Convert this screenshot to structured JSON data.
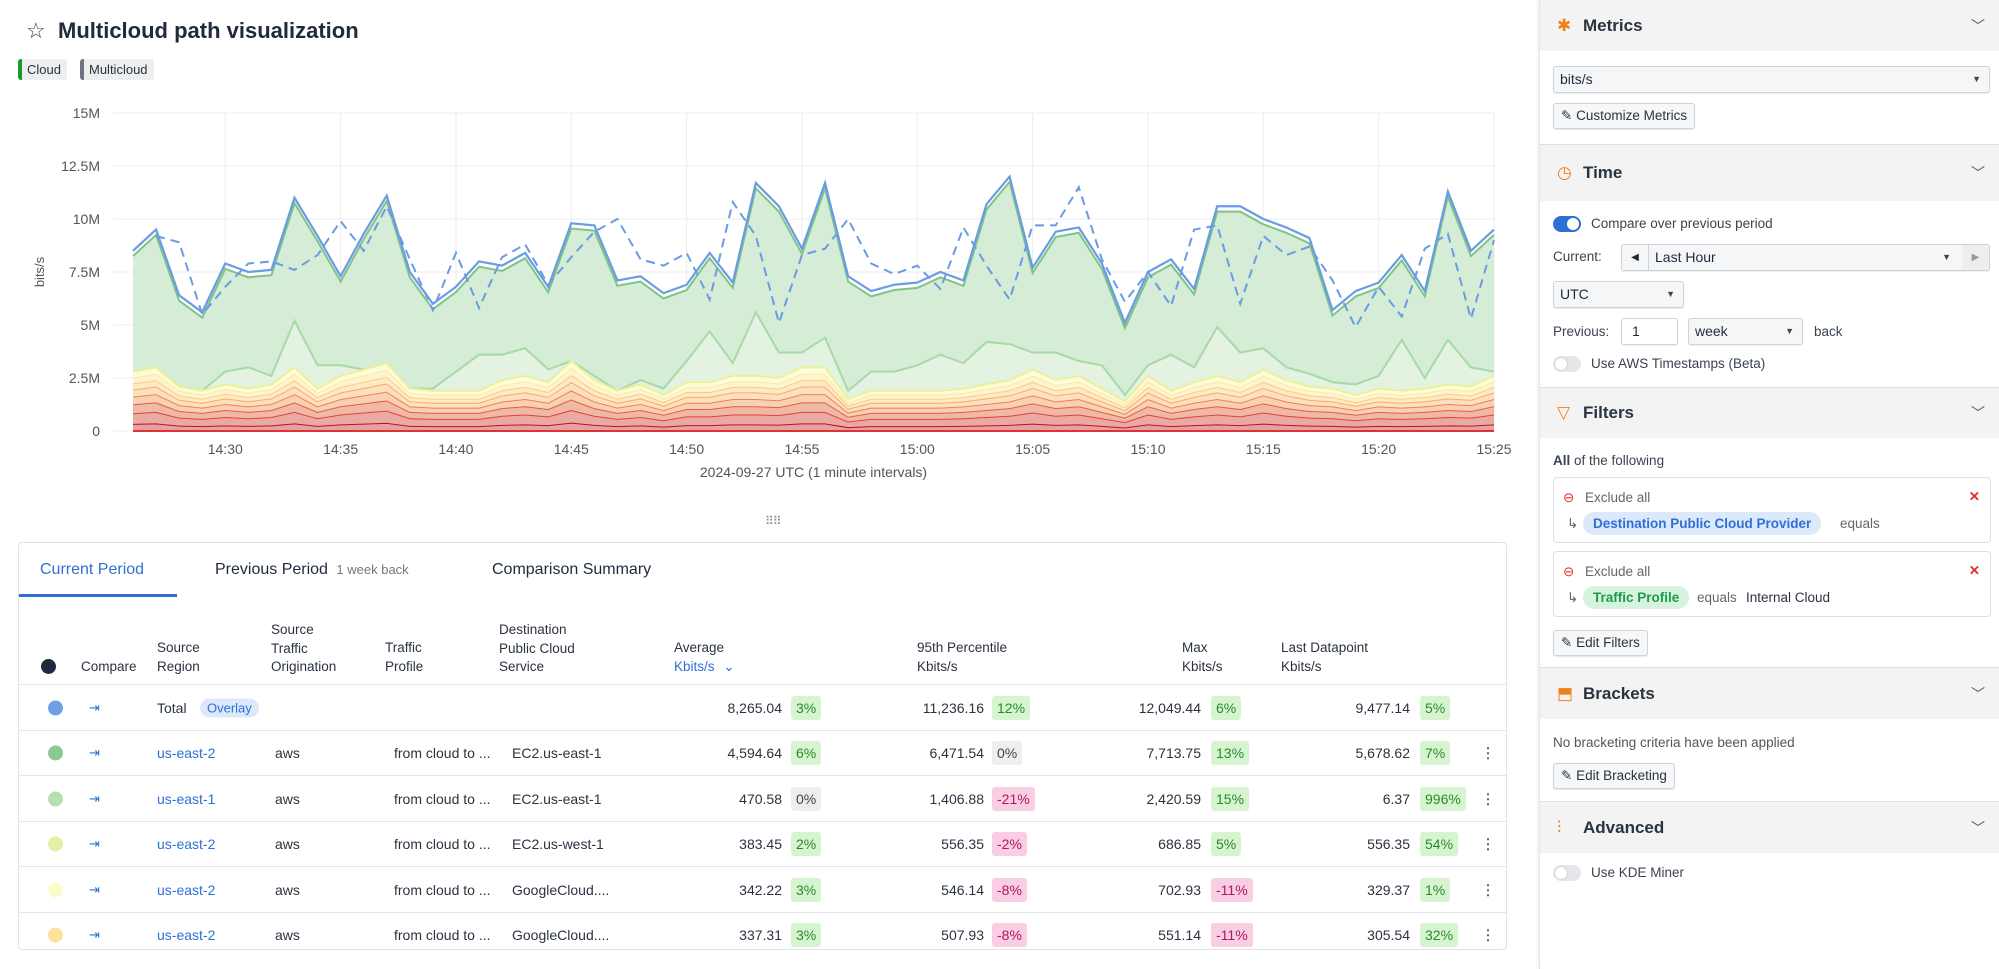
{
  "header": {
    "title": "Multicloud path visualization",
    "tags": [
      {
        "label": "Cloud",
        "color": "#1a9a2a"
      },
      {
        "label": "Multicloud",
        "color": "#6b7480"
      }
    ]
  },
  "chart_data": {
    "type": "area",
    "ylabel": "bits/s",
    "xlabel": "2024-09-27 UTC (1 minute intervals)",
    "ylim": [
      0,
      15000000
    ],
    "yticks": [
      "0",
      "2.5M",
      "5M",
      "7.5M",
      "10M",
      "12.5M",
      "15M"
    ],
    "ytick_values": [
      0,
      2.5,
      5,
      7.5,
      10,
      12.5,
      15
    ],
    "xticks": [
      "14:30",
      "14:35",
      "14:40",
      "14:45",
      "14:50",
      "14:55",
      "15:00",
      "15:05",
      "15:10",
      "15:15",
      "15:20",
      "15:25"
    ],
    "grid": true,
    "x": [
      "14:26",
      "14:27",
      "14:28",
      "14:29",
      "14:30",
      "14:31",
      "14:32",
      "14:33",
      "14:34",
      "14:35",
      "14:36",
      "14:37",
      "14:38",
      "14:39",
      "14:40",
      "14:41",
      "14:42",
      "14:43",
      "14:44",
      "14:45",
      "14:46",
      "14:47",
      "14:48",
      "14:49",
      "14:50",
      "14:51",
      "14:52",
      "14:53",
      "14:54",
      "14:55",
      "14:56",
      "14:57",
      "14:58",
      "14:59",
      "15:00",
      "15:01",
      "15:02",
      "15:03",
      "15:04",
      "15:05",
      "15:06",
      "15:07",
      "15:08",
      "15:09",
      "15:10",
      "15:11",
      "15:12",
      "15:13",
      "15:14",
      "15:15",
      "15:16",
      "15:17",
      "15:18",
      "15:19",
      "15:20",
      "15:21",
      "15:22",
      "15:23",
      "15:24",
      "15:25"
    ],
    "units": "M bits/s",
    "series": [
      {
        "role": "total",
        "color": "#6a9be3",
        "style": "solid",
        "values": [
          8.5,
          9.5,
          6.4,
          5.6,
          7.9,
          7.5,
          7.6,
          11.0,
          9.2,
          7.3,
          9.3,
          11.1,
          7.5,
          6.0,
          6.8,
          8.0,
          7.8,
          8.4,
          6.8,
          9.8,
          9.7,
          7.1,
          7.3,
          6.5,
          6.9,
          8.4,
          7.0,
          11.7,
          10.6,
          8.6,
          11.7,
          7.3,
          6.6,
          6.9,
          7.0,
          7.5,
          7.1,
          10.7,
          12.0,
          7.7,
          9.4,
          9.6,
          7.9,
          5.1,
          7.5,
          8.1,
          6.7,
          10.6,
          10.6,
          10.0,
          9.6,
          9.1,
          5.7,
          6.6,
          7.0,
          8.3,
          6.6,
          11.3,
          8.5,
          9.5
        ]
      },
      {
        "role": "previous-total",
        "color": "#6a9be3",
        "style": "dashed",
        "values": [
          null,
          9.2,
          8.9,
          5.5,
          6.8,
          7.9,
          8.0,
          7.6,
          8.3,
          9.9,
          8.5,
          10.6,
          8.1,
          5.7,
          8.4,
          5.8,
          8.2,
          8.8,
          6.9,
          8.2,
          9.4,
          10.0,
          8.1,
          7.8,
          8.4,
          6.2,
          10.8,
          9.2,
          5.1,
          8.3,
          8.6,
          10.0,
          7.9,
          7.4,
          7.8,
          6.7,
          9.6,
          7.8,
          6.2,
          9.7,
          9.7,
          11.5,
          8.1,
          6.1,
          7.5,
          5.9,
          9.5,
          9.7,
          6.0,
          9.2,
          8.3,
          8.7,
          7.1,
          4.9,
          6.8,
          5.4,
          8.6,
          9.3,
          5.3,
          9.0
        ]
      },
      {
        "role": "stack-light-green-top",
        "color": "#b4dfb0",
        "values": [
          2.8,
          3.0,
          2.1,
          1.9,
          2.8,
          3.0,
          2.6,
          5.2,
          3.1,
          3.1,
          2.9,
          3.2,
          2.0,
          2.0,
          2.8,
          3.6,
          3.6,
          3.9,
          2.9,
          3.3,
          2.6,
          1.9,
          2.4,
          2.0,
          3.3,
          4.7,
          3.2,
          5.6,
          3.7,
          3.7,
          4.4,
          1.9,
          2.8,
          2.8,
          3.1,
          3.6,
          3.2,
          4.2,
          4.1,
          3.7,
          3.7,
          3.3,
          3.1,
          1.7,
          3.1,
          3.6,
          3.0,
          4.9,
          3.7,
          3.9,
          3.0,
          2.7,
          2.3,
          2.2,
          2.6,
          4.3,
          2.5,
          4.3,
          3.0,
          2.8
        ]
      },
      {
        "role": "stack-remaining-top",
        "color": "#e6f0a4",
        "values": [
          2.8,
          3.0,
          2.1,
          1.9,
          2.2,
          2.0,
          2.2,
          3.0,
          2.0,
          2.6,
          2.9,
          3.2,
          2.0,
          1.9,
          1.9,
          1.9,
          2.4,
          2.6,
          2.3,
          3.3,
          2.4,
          1.9,
          2.2,
          1.7,
          2.3,
          2.3,
          2.6,
          2.6,
          2.5,
          3.0,
          3.0,
          1.5,
          1.9,
          1.9,
          1.9,
          1.9,
          2.0,
          2.2,
          2.4,
          2.9,
          2.4,
          2.6,
          2.0,
          1.4,
          2.6,
          1.9,
          2.3,
          2.6,
          2.3,
          2.9,
          2.4,
          2.1,
          2.0,
          1.7,
          2.0,
          1.9,
          2.0,
          2.2,
          2.1,
          2.6
        ]
      }
    ]
  },
  "table": {
    "tabs": [
      {
        "label": "Current Period"
      },
      {
        "label": "Previous Period",
        "sub": "1 week back"
      },
      {
        "label": "Comparison Summary"
      }
    ],
    "headers": {
      "compare": "Compare",
      "source_region": [
        "Source",
        "Region"
      ],
      "source_traffic": [
        "Source",
        "Traffic",
        "Origination"
      ],
      "traffic_profile": [
        "Traffic",
        "Profile"
      ],
      "destination": [
        "Destination",
        "Public Cloud",
        "Service"
      ],
      "average": [
        "Average",
        "Kbits/s"
      ],
      "p95": [
        "95th Percentile",
        "Kbits/s"
      ],
      "max": [
        "Max",
        "Kbits/s"
      ],
      "last": [
        "Last Datapoint",
        "Kbits/s"
      ]
    },
    "total": {
      "label": "Total",
      "pill": "Overlay",
      "color": "#6fa0e6",
      "avg": "8,265.04",
      "avg_d": "3%",
      "avg_t": "pos",
      "p95": "11,236.16",
      "p95_d": "12%",
      "p95_t": "pos",
      "max": "12,049.44",
      "max_d": "6%",
      "max_t": "pos",
      "last": "9,477.14",
      "last_d": "5%",
      "last_t": "pos"
    },
    "rows": [
      {
        "color": "#8cc990",
        "region": "us-east-2",
        "origin": "aws",
        "profile": "from cloud to ...",
        "dest": "EC2.us-east-1",
        "avg": "4,594.64",
        "avg_d": "6%",
        "avg_t": "pos",
        "p95": "6,471.54",
        "p95_d": "0%",
        "p95_t": "zero",
        "max": "7,713.75",
        "max_d": "13%",
        "max_t": "pos",
        "last": "5,678.62",
        "last_d": "7%",
        "last_t": "pos"
      },
      {
        "color": "#b4dfb0",
        "region": "us-east-1",
        "origin": "aws",
        "profile": "from cloud to ...",
        "dest": "EC2.us-east-1",
        "avg": "470.58",
        "avg_d": "0%",
        "avg_t": "zero",
        "p95": "1,406.88",
        "p95_d": "-21%",
        "p95_t": "neg",
        "max": "2,420.59",
        "max_d": "15%",
        "max_t": "pos",
        "last": "6.37",
        "last_d": "996%",
        "last_t": "pos"
      },
      {
        "color": "#e6f0a4",
        "region": "us-east-2",
        "origin": "aws",
        "profile": "from cloud to ...",
        "dest": "EC2.us-west-1",
        "avg": "383.45",
        "avg_d": "2%",
        "avg_t": "pos",
        "p95": "556.35",
        "p95_d": "-2%",
        "p95_t": "neg",
        "max": "686.85",
        "max_d": "5%",
        "max_t": "pos",
        "last": "556.35",
        "last_d": "54%",
        "last_t": "pos"
      },
      {
        "color": "#fdfbc9",
        "region": "us-east-2",
        "origin": "aws",
        "profile": "from cloud to ...",
        "dest": "GoogleCloud....",
        "avg": "342.22",
        "avg_d": "3%",
        "avg_t": "pos",
        "p95": "546.14",
        "p95_d": "-8%",
        "p95_t": "neg",
        "max": "702.93",
        "max_d": "-11%",
        "max_t": "neg",
        "last": "329.37",
        "last_d": "1%",
        "last_t": "pos"
      },
      {
        "color": "#fde29a",
        "region": "us-east-2",
        "origin": "aws",
        "profile": "from cloud to ...",
        "dest": "GoogleCloud....",
        "avg": "337.31",
        "avg_d": "3%",
        "avg_t": "pos",
        "p95": "507.93",
        "p95_d": "-8%",
        "p95_t": "neg",
        "max": "551.14",
        "max_d": "-11%",
        "max_t": "neg",
        "last": "305.54",
        "last_d": "32%",
        "last_t": "pos"
      }
    ]
  },
  "sidebar": {
    "metrics": {
      "title": "Metrics",
      "selected": "bits/s",
      "customize": "Customize Metrics"
    },
    "time": {
      "title": "Time",
      "compare_label": "Compare over previous period",
      "compare_on": true,
      "current_label": "Current:",
      "current_value": "Last Hour",
      "timezone": "UTC",
      "previous_label": "Previous:",
      "previous_value": "1",
      "previous_unit": "week",
      "back": "back",
      "aws_label": "Use AWS Timestamps (Beta)",
      "aws_on": false
    },
    "filters": {
      "title": "Filters",
      "all_bold": "All",
      "all_rest": " of the following",
      "items": [
        {
          "mode": "Exclude all",
          "field": "Destination Public Cloud Provider",
          "op": "equals",
          "value": ""
        },
        {
          "mode": "Exclude all",
          "field": "Traffic Profile",
          "op": "equals",
          "value": "Internal Cloud"
        }
      ],
      "edit": "Edit Filters"
    },
    "brackets": {
      "title": "Brackets",
      "empty": "No bracketing criteria have been applied",
      "edit": "Edit Bracketing"
    },
    "advanced": {
      "title": "Advanced",
      "kde_label": "Use KDE Miner",
      "kde_on": false
    }
  }
}
